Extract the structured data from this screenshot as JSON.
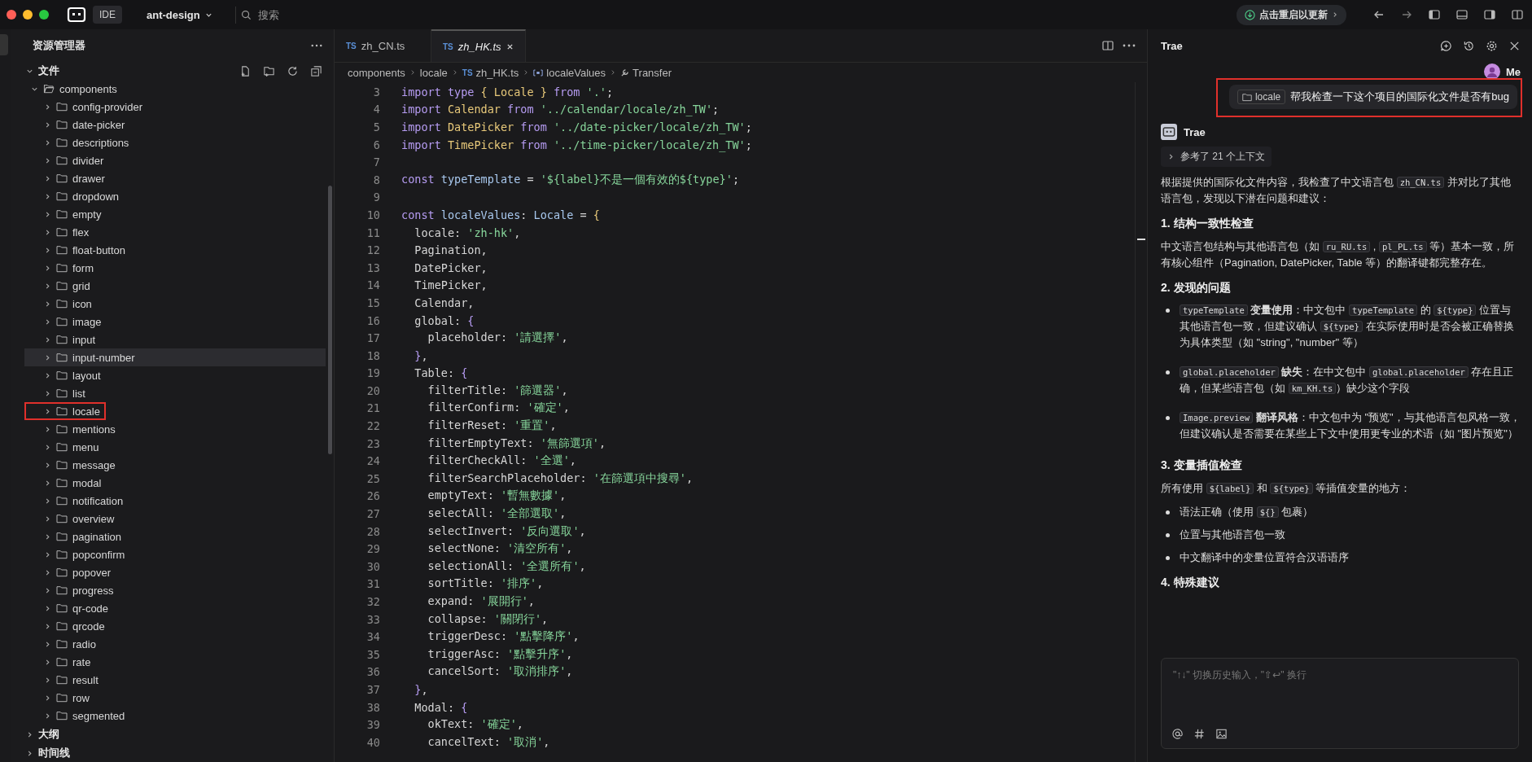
{
  "topbar": {
    "app_button": "IDE",
    "project": "ant-design",
    "search": {
      "placeholder": "搜索"
    },
    "update_button": "点击重启以更新"
  },
  "sidebar": {
    "title": "资源管理器",
    "sections": [
      {
        "label": "文件",
        "expanded": true,
        "tree": [
          {
            "name": "components",
            "expanded": true,
            "selected": false,
            "marked": false,
            "children": [
              {
                "name": "config-provider",
                "expanded": false,
                "selected": false,
                "marked": false
              },
              {
                "name": "date-picker",
                "expanded": false,
                "selected": false,
                "marked": false
              },
              {
                "name": "descriptions",
                "expanded": false,
                "selected": false,
                "marked": false
              },
              {
                "name": "divider",
                "expanded": false,
                "selected": false,
                "marked": false
              },
              {
                "name": "drawer",
                "expanded": false,
                "selected": false,
                "marked": false
              },
              {
                "name": "dropdown",
                "expanded": false,
                "selected": false,
                "marked": false
              },
              {
                "name": "empty",
                "expanded": false,
                "selected": false,
                "marked": false
              },
              {
                "name": "flex",
                "expanded": false,
                "selected": false,
                "marked": false
              },
              {
                "name": "float-button",
                "expanded": false,
                "selected": false,
                "marked": false
              },
              {
                "name": "form",
                "expanded": false,
                "selected": false,
                "marked": false
              },
              {
                "name": "grid",
                "expanded": false,
                "selected": false,
                "marked": false
              },
              {
                "name": "icon",
                "expanded": false,
                "selected": false,
                "marked": false
              },
              {
                "name": "image",
                "expanded": false,
                "selected": false,
                "marked": false
              },
              {
                "name": "input",
                "expanded": false,
                "selected": false,
                "marked": false
              },
              {
                "name": "input-number",
                "expanded": false,
                "selected": true,
                "marked": false
              },
              {
                "name": "layout",
                "expanded": false,
                "selected": false,
                "marked": false
              },
              {
                "name": "list",
                "expanded": false,
                "selected": false,
                "marked": false
              },
              {
                "name": "locale",
                "expanded": false,
                "selected": false,
                "marked": true
              },
              {
                "name": "mentions",
                "expanded": false,
                "selected": false,
                "marked": false
              },
              {
                "name": "menu",
                "expanded": false,
                "selected": false,
                "marked": false
              },
              {
                "name": "message",
                "expanded": false,
                "selected": false,
                "marked": false
              },
              {
                "name": "modal",
                "expanded": false,
                "selected": false,
                "marked": false
              },
              {
                "name": "notification",
                "expanded": false,
                "selected": false,
                "marked": false
              },
              {
                "name": "overview",
                "expanded": false,
                "selected": false,
                "marked": false
              },
              {
                "name": "pagination",
                "expanded": false,
                "selected": false,
                "marked": false
              },
              {
                "name": "popconfirm",
                "expanded": false,
                "selected": false,
                "marked": false
              },
              {
                "name": "popover",
                "expanded": false,
                "selected": false,
                "marked": false
              },
              {
                "name": "progress",
                "expanded": false,
                "selected": false,
                "marked": false
              },
              {
                "name": "qr-code",
                "expanded": false,
                "selected": false,
                "marked": false
              },
              {
                "name": "qrcode",
                "expanded": false,
                "selected": false,
                "marked": false
              },
              {
                "name": "radio",
                "expanded": false,
                "selected": false,
                "marked": false
              },
              {
                "name": "rate",
                "expanded": false,
                "selected": false,
                "marked": false
              },
              {
                "name": "result",
                "expanded": false,
                "selected": false,
                "marked": false
              },
              {
                "name": "row",
                "expanded": false,
                "selected": false,
                "marked": false
              },
              {
                "name": "segmented",
                "expanded": false,
                "selected": false,
                "marked": false
              }
            ]
          }
        ]
      },
      {
        "label": "大纲",
        "expanded": false
      },
      {
        "label": "时间线",
        "expanded": false
      }
    ]
  },
  "editor": {
    "tabs": [
      {
        "icon_text": "TS",
        "label": "zh_CN.ts",
        "selected": false
      },
      {
        "icon_text": "TS",
        "label": "zh_HK.ts",
        "selected": true
      }
    ],
    "breadcrumb": [
      {
        "kind": "folder",
        "label": "components"
      },
      {
        "kind": "folder",
        "label": "locale"
      },
      {
        "kind": "file",
        "icon_text": "TS",
        "label": "zh_HK.ts"
      },
      {
        "kind": "variable",
        "label": "localeValues"
      },
      {
        "kind": "property",
        "label": "Transfer"
      }
    ],
    "lines": [
      {
        "n": "3",
        "tokens": [
          {
            "kind": "kw",
            "text": "import type"
          },
          {
            "kind": "brace",
            "text": " {"
          },
          {
            "kind": "type",
            "text": " Locale"
          },
          {
            "kind": "brace",
            "text": " }"
          },
          {
            "kind": "kw",
            "text": " from"
          },
          {
            "kind": "str",
            "text": " '.'"
          },
          {
            "kind": "plain",
            "text": ";"
          }
        ]
      },
      {
        "n": "4",
        "tokens": [
          {
            "kind": "kw",
            "text": "import"
          },
          {
            "kind": "type",
            "text": " Calendar"
          },
          {
            "kind": "kw",
            "text": " from"
          },
          {
            "kind": "str",
            "text": " '../calendar/locale/zh_TW'"
          },
          {
            "kind": "plain",
            "text": ";"
          }
        ]
      },
      {
        "n": "5",
        "tokens": [
          {
            "kind": "kw",
            "text": "import"
          },
          {
            "kind": "type",
            "text": " DatePicker"
          },
          {
            "kind": "kw",
            "text": " from"
          },
          {
            "kind": "str",
            "text": " '../date-picker/locale/zh_TW'"
          },
          {
            "kind": "plain",
            "text": ";"
          }
        ]
      },
      {
        "n": "6",
        "tokens": [
          {
            "kind": "kw",
            "text": "import"
          },
          {
            "kind": "type",
            "text": " TimePicker"
          },
          {
            "kind": "kw",
            "text": " from"
          },
          {
            "kind": "str",
            "text": " '../time-picker/locale/zh_TW'"
          },
          {
            "kind": "plain",
            "text": ";"
          }
        ]
      },
      {
        "n": "7"
      },
      {
        "n": "8",
        "tokens": [
          {
            "kind": "kw",
            "text": "const"
          },
          {
            "kind": "var",
            "text": " typeTemplate"
          },
          {
            "kind": "plain",
            "text": " ="
          },
          {
            "kind": "str",
            "text": " '${label}不是一個有效的${type}'"
          },
          {
            "kind": "plain",
            "text": ";"
          }
        ]
      },
      {
        "n": "9"
      },
      {
        "n": "10",
        "tokens": [
          {
            "kind": "kw",
            "text": "const"
          },
          {
            "kind": "var",
            "text": " localeValues"
          },
          {
            "kind": "plain",
            "text": ":"
          },
          {
            "kind": "var",
            "text": " Locale"
          },
          {
            "kind": "plain",
            "text": " ="
          },
          {
            "kind": "brace",
            "text": " {"
          }
        ]
      },
      {
        "n": "11",
        "tokens": [
          {
            "kind": "plain",
            "text": "  locale:"
          },
          {
            "kind": "str",
            "text": " 'zh-hk'"
          },
          {
            "kind": "plain",
            "text": ","
          }
        ]
      },
      {
        "n": "12",
        "tokens": [
          {
            "kind": "plain",
            "text": "  Pagination,"
          }
        ]
      },
      {
        "n": "13",
        "tokens": [
          {
            "kind": "plain",
            "text": "  DatePicker,"
          }
        ]
      },
      {
        "n": "14",
        "tokens": [
          {
            "kind": "plain",
            "text": "  TimePicker,"
          }
        ]
      },
      {
        "n": "15",
        "tokens": [
          {
            "kind": "plain",
            "text": "  Calendar,"
          }
        ]
      },
      {
        "n": "16",
        "tokens": [
          {
            "kind": "plain",
            "text": "  global:"
          },
          {
            "kind": "kw",
            "text": " {"
          }
        ]
      },
      {
        "n": "17",
        "tokens": [
          {
            "kind": "plain",
            "text": "    placeholder:"
          },
          {
            "kind": "str",
            "text": " '請選擇'"
          },
          {
            "kind": "plain",
            "text": ","
          }
        ]
      },
      {
        "n": "18",
        "tokens": [
          {
            "kind": "kw",
            "text": "  }"
          },
          {
            "kind": "plain",
            "text": ","
          }
        ]
      },
      {
        "n": "19",
        "tokens": [
          {
            "kind": "plain",
            "text": "  Table:"
          },
          {
            "kind": "kw",
            "text": " {"
          }
        ]
      },
      {
        "n": "20",
        "tokens": [
          {
            "kind": "plain",
            "text": "    filterTitle:"
          },
          {
            "kind": "str",
            "text": " '篩選器'"
          },
          {
            "kind": "plain",
            "text": ","
          }
        ]
      },
      {
        "n": "21",
        "tokens": [
          {
            "kind": "plain",
            "text": "    filterConfirm:"
          },
          {
            "kind": "str",
            "text": " '確定'"
          },
          {
            "kind": "plain",
            "text": ","
          }
        ]
      },
      {
        "n": "22",
        "tokens": [
          {
            "kind": "plain",
            "text": "    filterReset:"
          },
          {
            "kind": "str",
            "text": " '重置'"
          },
          {
            "kind": "plain",
            "text": ","
          }
        ]
      },
      {
        "n": "23",
        "tokens": [
          {
            "kind": "plain",
            "text": "    filterEmptyText:"
          },
          {
            "kind": "str",
            "text": " '無篩選項'"
          },
          {
            "kind": "plain",
            "text": ","
          }
        ]
      },
      {
        "n": "24",
        "tokens": [
          {
            "kind": "plain",
            "text": "    filterCheckAll:"
          },
          {
            "kind": "str",
            "text": " '全選'"
          },
          {
            "kind": "plain",
            "text": ","
          }
        ]
      },
      {
        "n": "25",
        "tokens": [
          {
            "kind": "plain",
            "text": "    filterSearchPlaceholder:"
          },
          {
            "kind": "str",
            "text": " '在篩選項中搜尋'"
          },
          {
            "kind": "plain",
            "text": ","
          }
        ]
      },
      {
        "n": "26",
        "tokens": [
          {
            "kind": "plain",
            "text": "    emptyText:"
          },
          {
            "kind": "str",
            "text": " '暫無數據'"
          },
          {
            "kind": "plain",
            "text": ","
          }
        ]
      },
      {
        "n": "27",
        "tokens": [
          {
            "kind": "plain",
            "text": "    selectAll:"
          },
          {
            "kind": "str",
            "text": " '全部選取'"
          },
          {
            "kind": "plain",
            "text": ","
          }
        ]
      },
      {
        "n": "28",
        "tokens": [
          {
            "kind": "plain",
            "text": "    selectInvert:"
          },
          {
            "kind": "str",
            "text": " '反向選取'"
          },
          {
            "kind": "plain",
            "text": ","
          }
        ]
      },
      {
        "n": "29",
        "tokens": [
          {
            "kind": "plain",
            "text": "    selectNone:"
          },
          {
            "kind": "str",
            "text": " '清空所有'"
          },
          {
            "kind": "plain",
            "text": ","
          }
        ]
      },
      {
        "n": "30",
        "tokens": [
          {
            "kind": "plain",
            "text": "    selectionAll:"
          },
          {
            "kind": "str",
            "text": " '全選所有'"
          },
          {
            "kind": "plain",
            "text": ","
          }
        ]
      },
      {
        "n": "31",
        "tokens": [
          {
            "kind": "plain",
            "text": "    sortTitle:"
          },
          {
            "kind": "str",
            "text": " '排序'"
          },
          {
            "kind": "plain",
            "text": ","
          }
        ]
      },
      {
        "n": "32",
        "tokens": [
          {
            "kind": "plain",
            "text": "    expand:"
          },
          {
            "kind": "str",
            "text": " '展開行'"
          },
          {
            "kind": "plain",
            "text": ","
          }
        ]
      },
      {
        "n": "33",
        "tokens": [
          {
            "kind": "plain",
            "text": "    collapse:"
          },
          {
            "kind": "str",
            "text": " '關閉行'"
          },
          {
            "kind": "plain",
            "text": ","
          }
        ]
      },
      {
        "n": "34",
        "tokens": [
          {
            "kind": "plain",
            "text": "    triggerDesc:"
          },
          {
            "kind": "str",
            "text": " '點擊降序'"
          },
          {
            "kind": "plain",
            "text": ","
          }
        ]
      },
      {
        "n": "35",
        "tokens": [
          {
            "kind": "plain",
            "text": "    triggerAsc:"
          },
          {
            "kind": "str",
            "text": " '點擊升序'"
          },
          {
            "kind": "plain",
            "text": ","
          }
        ]
      },
      {
        "n": "36",
        "tokens": [
          {
            "kind": "plain",
            "text": "    cancelSort:"
          },
          {
            "kind": "str",
            "text": " '取消排序'"
          },
          {
            "kind": "plain",
            "text": ","
          }
        ]
      },
      {
        "n": "37",
        "tokens": [
          {
            "kind": "kw",
            "text": "  }"
          },
          {
            "kind": "plain",
            "text": ","
          }
        ]
      },
      {
        "n": "38",
        "tokens": [
          {
            "kind": "plain",
            "text": "  Modal:"
          },
          {
            "kind": "kw",
            "text": " {"
          }
        ]
      },
      {
        "n": "39",
        "tokens": [
          {
            "kind": "plain",
            "text": "    okText:"
          },
          {
            "kind": "str",
            "text": " '確定'"
          },
          {
            "kind": "plain",
            "text": ","
          }
        ]
      },
      {
        "n": "40",
        "tokens": [
          {
            "kind": "plain",
            "text": "    cancelText:"
          },
          {
            "kind": "str",
            "text": " '取消'"
          },
          {
            "kind": "plain",
            "text": ","
          }
        ]
      }
    ]
  },
  "chat": {
    "title": "Trae",
    "user": {
      "name": "Me",
      "marked": true,
      "context_chip": "locale",
      "message": "帮我检查一下这个项目的国际化文件是否有bug"
    },
    "assistant": {
      "name": "Trae",
      "context_toggle": {
        "label": "参考了 21 个上下文",
        "expanded": false
      },
      "blocks": [
        {
          "kind": "p",
          "segments": [
            {
              "kind": "text",
              "text": "根据提供的国际化文件内容，我检查了中文语言包 "
            },
            {
              "kind": "code",
              "text": "zh_CN.ts"
            },
            {
              "kind": "text",
              "text": " 并对比了其他语言包，发现以下潜在问题和建议："
            }
          ]
        },
        {
          "kind": "h",
          "text": "1. 结构一致性检查"
        },
        {
          "kind": "p",
          "segments": [
            {
              "kind": "text",
              "text": "中文语言包结构与其他语言包（如 "
            },
            {
              "kind": "code",
              "text": "ru_RU.ts"
            },
            {
              "kind": "text",
              "text": " , "
            },
            {
              "kind": "code",
              "text": "pl_PL.ts"
            },
            {
              "kind": "text",
              "text": " 等）基本一致，所有核心组件（Pagination, DatePicker, Table 等）的翻译键都完整存在。"
            }
          ]
        },
        {
          "kind": "h",
          "text": "2. 发现的问题"
        },
        {
          "kind": "ul",
          "spaced": true,
          "items": [
            [
              {
                "kind": "code",
                "text": "typeTemplate"
              },
              {
                "kind": "bold",
                "text": " 变量使用"
              },
              {
                "kind": "text",
                "text": "：中文包中 "
              },
              {
                "kind": "code",
                "text": "typeTemplate"
              },
              {
                "kind": "text",
                "text": " 的 "
              },
              {
                "kind": "code",
                "text": "${type}"
              },
              {
                "kind": "text",
                "text": " 位置与其他语言包一致，但建议确认 "
              },
              {
                "kind": "code",
                "text": "${type}"
              },
              {
                "kind": "text",
                "text": " 在实际使用时是否会被正确替换为具体类型（如 \"string\", \"number\" 等）"
              }
            ],
            [
              {
                "kind": "code",
                "text": "global.placeholder"
              },
              {
                "kind": "bold",
                "text": " 缺失"
              },
              {
                "kind": "text",
                "text": "：在中文包中 "
              },
              {
                "kind": "code",
                "text": "global.placeholder"
              },
              {
                "kind": "text",
                "text": " 存在且正确，但某些语言包（如 "
              },
              {
                "kind": "code",
                "text": "km_KH.ts"
              },
              {
                "kind": "text",
                "text": "）缺少这个字段"
              }
            ],
            [
              {
                "kind": "code",
                "text": "Image.preview"
              },
              {
                "kind": "bold",
                "text": " 翻译风格"
              },
              {
                "kind": "text",
                "text": "：中文包中为 \"预览\"，与其他语言包风格一致，但建议确认是否需要在某些上下文中使用更专业的术语（如 \"图片预览\"）"
              }
            ]
          ]
        },
        {
          "kind": "h",
          "text": "3. 变量插值检查"
        },
        {
          "kind": "p",
          "segments": [
            {
              "kind": "text",
              "text": "所有使用 "
            },
            {
              "kind": "code",
              "text": "${label}"
            },
            {
              "kind": "text",
              "text": " 和 "
            },
            {
              "kind": "code",
              "text": "${type}"
            },
            {
              "kind": "text",
              "text": " 等插值变量的地方："
            }
          ]
        },
        {
          "kind": "ul",
          "spaced": false,
          "items": [
            [
              {
                "kind": "text",
                "text": "语法正确（使用 "
              },
              {
                "kind": "code",
                "text": "${}"
              },
              {
                "kind": "text",
                "text": " 包裹）"
              }
            ],
            [
              {
                "kind": "text",
                "text": "位置与其他语言包一致"
              }
            ],
            [
              {
                "kind": "text",
                "text": "中文翻译中的变量位置符合汉语语序"
              }
            ]
          ]
        },
        {
          "kind": "h",
          "text": "4. 特殊建议"
        }
      ]
    },
    "input": {
      "placeholder": "\"↑↓\" 切换历史输入，\"⇧↩\" 换行"
    }
  }
}
